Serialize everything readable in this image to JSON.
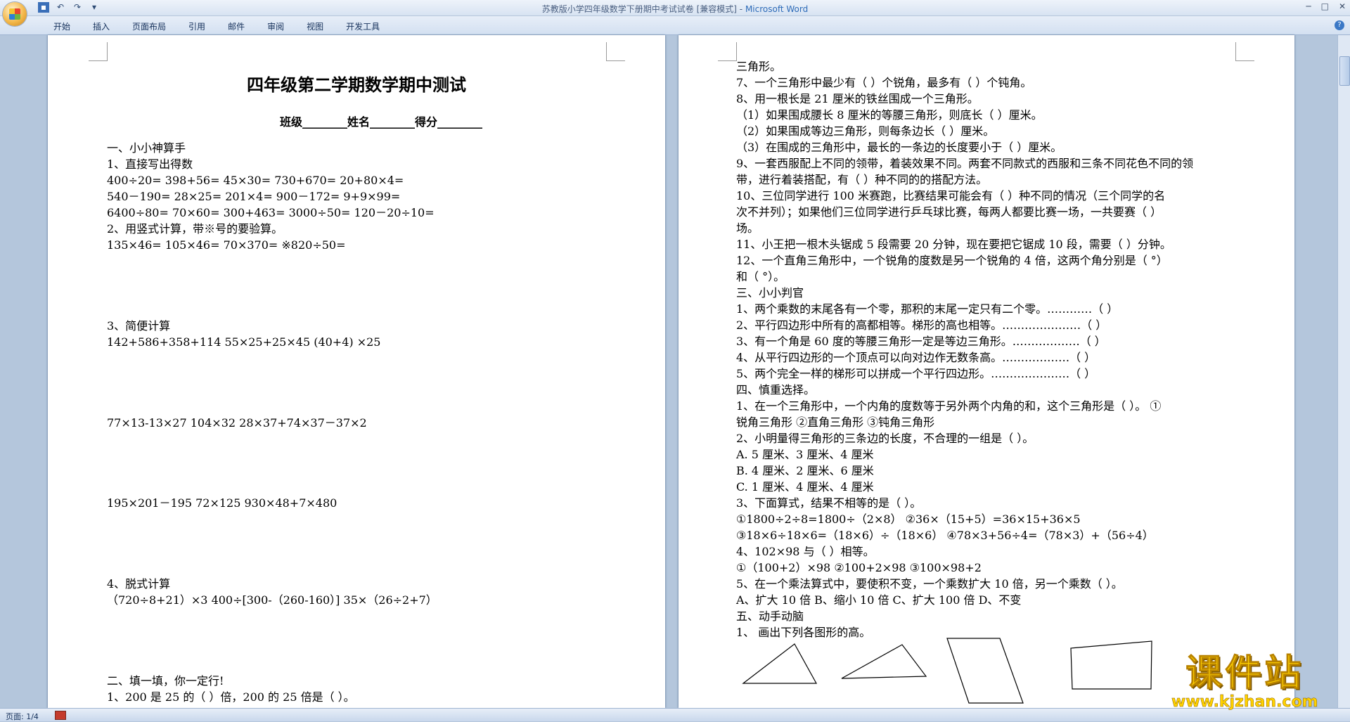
{
  "window": {
    "title": "苏教版小学四年级数学下册期中考试试卷 [兼容模式] -",
    "app": "Microsoft Word"
  },
  "ribbon": {
    "tabs": [
      "开始",
      "插入",
      "页面布局",
      "引用",
      "邮件",
      "审阅",
      "视图",
      "开发工具"
    ]
  },
  "status": {
    "page": "页面: 1/4"
  },
  "watermark": {
    "text": "课件站",
    "url": "www.kjzhan.com"
  },
  "page1": {
    "title": "四年级第二学期数学期中测试",
    "lines": [
      "班级________姓名________得分________",
      "一、小小神算手",
      "1、直接写出得数",
      "400÷20=        398+56=        45×30=        730+670=        20+80×4=",
      "540－190=      28×25=         201×4=        900－172=       9+9×99=",
      "6400÷80=       70×60=         300+463=      3000÷50=        120－20÷10=",
      "2、用竖式计算，带※号的要验算。",
      "135×46=              105×46=              70×370=              ※820÷50=",
      "3、简便计算",
      "142+586+358+114         55×25+25×45              (40+4) ×25",
      "77×13-13×27              104×32                28×37+74×37－37×2",
      "195×201－195             72×125                930×48+7×480",
      "4、脱式计算",
      "（720÷8+21）×3         400÷[300-（260-160）]         35×（26÷2+7）",
      "二、填一填，你一定行!",
      "1、200 是 25 的（      ）倍，200 的 25 倍是（      ）。"
    ]
  },
  "page2": {
    "lines": [
      "三角形。",
      "7、一个三角形中最少有（       ）个锐角，最多有（       ）个钝角。",
      "8、用一根长是 21 厘米的铁丝围成一个三角形。",
      "（1）如果围成腰长 8 厘米的等腰三角形，则底长（       ）厘米。",
      "（2）如果围成等边三角形，则每条边长（       ）厘米。",
      "（3）在围成的三角形中，最长的一条边的长度要小于（       ）厘米。",
      "9、一套西服配上不同的领带，着装效果不同。两套不同款式的西服和三条不同花色不同的领",
      "带，进行着装搭配，有（       ）种不同的的搭配方法。",
      "10、三位同学进行 100 米赛跑，比赛结果可能会有（       ）种不同的情况（三个同学的名",
      "次不并列）；如果他们三位同学进行乒乓球比赛，每两人都要比赛一场，一共要赛（       ）",
      "场。",
      "11、小王把一根木头锯成 5 段需要 20 分钟，现在要把它锯成 10 段，需要（     ）分钟。",
      "12、一个直角三角形中，一个锐角的度数是另一个锐角的 4 倍，这两个角分别是（      °）",
      "和（      °）。",
      "三、小小判官",
      "1、两个乘数的末尾各有一个零，那积的末尾一定只有二个零。…………（     ）",
      "2、平行四边形中所有的高都相等。梯形的高也相等。…………………（     ）",
      "3、有一个角是 60 度的等腰三角形一定是等边三角形。………………（     ）",
      "4、从平行四边形的一个顶点可以向对边作无数条高。………………（     ）",
      "5、两个完全一样的梯形可以拼成一个平行四边形。…………………（     ）",
      "四、慎重选择。",
      "1、在一个三角形中，一个内角的度数等于另外两个内角的和，这个三角形是（       ）。   ①",
      "锐角三角形        ②直角三角形        ③钝角三角形",
      "2、小明量得三角形的三条边的长度，不合理的一组是（       ）。",
      "A. 5 厘米、3 厘米、4 厘米",
      "B. 4 厘米、2 厘米、6 厘米",
      "C. 1 厘米、4 厘米、4 厘米",
      "3、下面算式，结果不相等的是（       ）。",
      "①1800÷2÷8=1800÷（2×8）          ②36×（15+5）=36×15+36×5",
      "③18×6÷18×6=（18×6）÷（18×6）    ④78×3+56÷4=（78×3）+（56÷4）",
      "4、102×98 与（       ）相等。",
      "①（100+2）×98          ②100+2×98          ③100×98+2",
      "5、在一个乘法算式中，要使积不变，一个乘数扩大 10 倍，另一个乘数（       ）。",
      "A、扩大 10 倍        B、缩小 10 倍        C、扩大 100 倍        D、不变",
      "五、动手动脑",
      "1、                        画出下列各图形的高。"
    ]
  }
}
